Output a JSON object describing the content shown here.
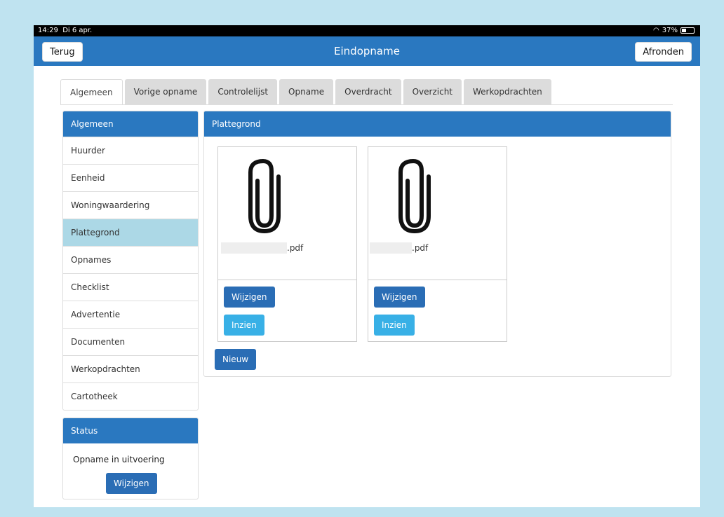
{
  "statusbar": {
    "time": "14:29",
    "date": "Di 6 apr.",
    "battery": "37%",
    "battery_level": 0.37,
    "wifi_icon": "wifi-icon"
  },
  "navbar": {
    "back_label": "Terug",
    "title": "Eindopname",
    "finish_label": "Afronden"
  },
  "tabs": [
    {
      "label": "Algemeen",
      "active": true
    },
    {
      "label": "Vorige opname"
    },
    {
      "label": "Controlelijst"
    },
    {
      "label": "Opname"
    },
    {
      "label": "Overdracht"
    },
    {
      "label": "Overzicht"
    },
    {
      "label": "Werkopdrachten"
    }
  ],
  "sidebar": {
    "title": "Algemeen",
    "items": [
      {
        "label": "Huurder"
      },
      {
        "label": "Eenheid"
      },
      {
        "label": "Woningwaardering"
      },
      {
        "label": "Plattegrond",
        "active": true
      },
      {
        "label": "Opnames"
      },
      {
        "label": "Checklist"
      },
      {
        "label": "Advertentie"
      },
      {
        "label": "Documenten"
      },
      {
        "label": "Werkopdrachten"
      },
      {
        "label": "Cartotheek"
      }
    ]
  },
  "status_panel": {
    "title": "Status",
    "text": "Opname in uitvoering",
    "edit_label": "Wijzigen"
  },
  "main": {
    "title": "Plattegrond",
    "files": [
      {
        "name": ".pdf",
        "icon": "paperclip-icon",
        "edit_label": "Wijzigen",
        "view_label": "Inzien"
      },
      {
        "name": ".pdf",
        "icon": "paperclip-icon",
        "edit_label": "Wijzigen",
        "view_label": "Inzien"
      }
    ],
    "new_label": "Nieuw"
  },
  "colors": {
    "primary": "#2a78c0",
    "button": "#2a6db5",
    "info": "#38b0e6",
    "active_item": "#acd8e6",
    "background": "#bfe3f0"
  }
}
